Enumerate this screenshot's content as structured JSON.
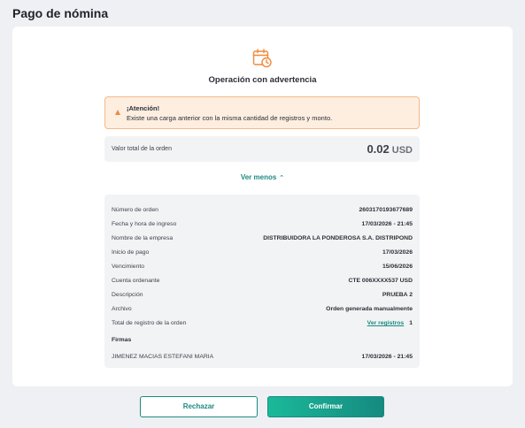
{
  "page": {
    "title": "Pago de nómina"
  },
  "operation": {
    "icon": "calendar-clock-icon",
    "title": "Operación con advertencia"
  },
  "alert": {
    "icon": "warning-icon",
    "title": "¡Atención!",
    "message": "Existe una carga anterior con la misma cantidad de registros y monto."
  },
  "total": {
    "label": "Valor total de la orden",
    "amount": "0.02",
    "currency": "USD"
  },
  "toggle": {
    "label": "Ver menos"
  },
  "details": {
    "rows": [
      {
        "label": "Número de orden",
        "value": "2603170193677689"
      },
      {
        "label": "Fecha y hora de ingreso",
        "value": "17/03/2026 - 21:45"
      },
      {
        "label": "Nombre de la empresa",
        "value": "DISTRIBUIDORA LA PONDEROSA S.A. DISTRIPOND"
      },
      {
        "label": "Inicio de pago",
        "value": "17/03/2026"
      },
      {
        "label": "Vencimiento",
        "value": "15/06/2026"
      },
      {
        "label": "Cuenta ordenante",
        "value": "CTE 006XXXX537 USD"
      },
      {
        "label": "Descripción",
        "value": "PRUEBA 2"
      },
      {
        "label": "Archivo",
        "value": "Orden generada manualmente"
      }
    ],
    "records": {
      "label": "Total de registro de la orden",
      "link": "Ver registros",
      "value": "1"
    },
    "firmas": {
      "title": "Firmas",
      "signer": {
        "name": "JIMENEZ MACIAS ESTEFANI MARIA",
        "datetime": "17/03/2026 - 21:45"
      }
    }
  },
  "actions": {
    "reject": "Rechazar",
    "confirm": "Confirmar"
  },
  "colors": {
    "accent": "#1a8a80",
    "warning_bg": "#fdeee0",
    "warning_border": "#f3b98a",
    "icon_orange": "#f08a3c"
  }
}
